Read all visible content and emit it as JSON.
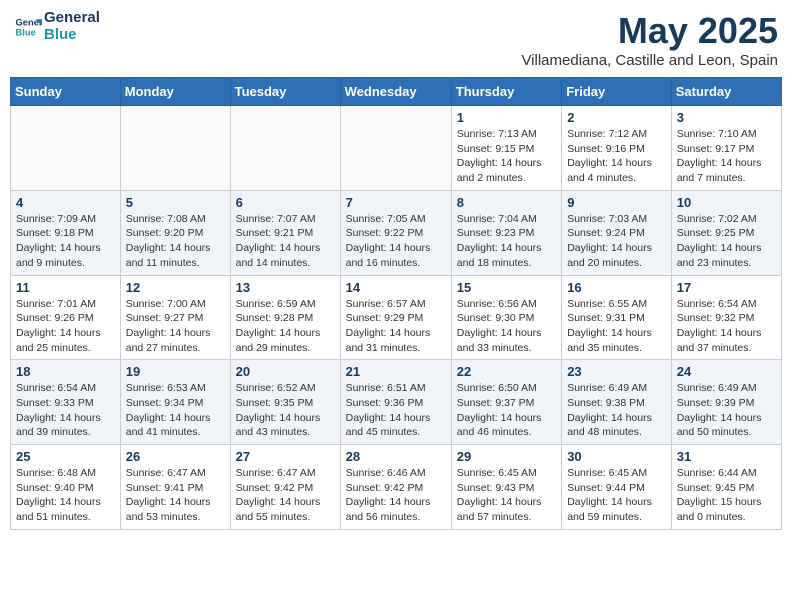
{
  "header": {
    "logo_line1": "General",
    "logo_line2": "Blue",
    "month": "May 2025",
    "location": "Villamediana, Castille and Leon, Spain"
  },
  "weekdays": [
    "Sunday",
    "Monday",
    "Tuesday",
    "Wednesday",
    "Thursday",
    "Friday",
    "Saturday"
  ],
  "weeks": [
    [
      {
        "day": "",
        "info": ""
      },
      {
        "day": "",
        "info": ""
      },
      {
        "day": "",
        "info": ""
      },
      {
        "day": "",
        "info": ""
      },
      {
        "day": "1",
        "info": "Sunrise: 7:13 AM\nSunset: 9:15 PM\nDaylight: 14 hours\nand 2 minutes."
      },
      {
        "day": "2",
        "info": "Sunrise: 7:12 AM\nSunset: 9:16 PM\nDaylight: 14 hours\nand 4 minutes."
      },
      {
        "day": "3",
        "info": "Sunrise: 7:10 AM\nSunset: 9:17 PM\nDaylight: 14 hours\nand 7 minutes."
      }
    ],
    [
      {
        "day": "4",
        "info": "Sunrise: 7:09 AM\nSunset: 9:18 PM\nDaylight: 14 hours\nand 9 minutes."
      },
      {
        "day": "5",
        "info": "Sunrise: 7:08 AM\nSunset: 9:20 PM\nDaylight: 14 hours\nand 11 minutes."
      },
      {
        "day": "6",
        "info": "Sunrise: 7:07 AM\nSunset: 9:21 PM\nDaylight: 14 hours\nand 14 minutes."
      },
      {
        "day": "7",
        "info": "Sunrise: 7:05 AM\nSunset: 9:22 PM\nDaylight: 14 hours\nand 16 minutes."
      },
      {
        "day": "8",
        "info": "Sunrise: 7:04 AM\nSunset: 9:23 PM\nDaylight: 14 hours\nand 18 minutes."
      },
      {
        "day": "9",
        "info": "Sunrise: 7:03 AM\nSunset: 9:24 PM\nDaylight: 14 hours\nand 20 minutes."
      },
      {
        "day": "10",
        "info": "Sunrise: 7:02 AM\nSunset: 9:25 PM\nDaylight: 14 hours\nand 23 minutes."
      }
    ],
    [
      {
        "day": "11",
        "info": "Sunrise: 7:01 AM\nSunset: 9:26 PM\nDaylight: 14 hours\nand 25 minutes."
      },
      {
        "day": "12",
        "info": "Sunrise: 7:00 AM\nSunset: 9:27 PM\nDaylight: 14 hours\nand 27 minutes."
      },
      {
        "day": "13",
        "info": "Sunrise: 6:59 AM\nSunset: 9:28 PM\nDaylight: 14 hours\nand 29 minutes."
      },
      {
        "day": "14",
        "info": "Sunrise: 6:57 AM\nSunset: 9:29 PM\nDaylight: 14 hours\nand 31 minutes."
      },
      {
        "day": "15",
        "info": "Sunrise: 6:56 AM\nSunset: 9:30 PM\nDaylight: 14 hours\nand 33 minutes."
      },
      {
        "day": "16",
        "info": "Sunrise: 6:55 AM\nSunset: 9:31 PM\nDaylight: 14 hours\nand 35 minutes."
      },
      {
        "day": "17",
        "info": "Sunrise: 6:54 AM\nSunset: 9:32 PM\nDaylight: 14 hours\nand 37 minutes."
      }
    ],
    [
      {
        "day": "18",
        "info": "Sunrise: 6:54 AM\nSunset: 9:33 PM\nDaylight: 14 hours\nand 39 minutes."
      },
      {
        "day": "19",
        "info": "Sunrise: 6:53 AM\nSunset: 9:34 PM\nDaylight: 14 hours\nand 41 minutes."
      },
      {
        "day": "20",
        "info": "Sunrise: 6:52 AM\nSunset: 9:35 PM\nDaylight: 14 hours\nand 43 minutes."
      },
      {
        "day": "21",
        "info": "Sunrise: 6:51 AM\nSunset: 9:36 PM\nDaylight: 14 hours\nand 45 minutes."
      },
      {
        "day": "22",
        "info": "Sunrise: 6:50 AM\nSunset: 9:37 PM\nDaylight: 14 hours\nand 46 minutes."
      },
      {
        "day": "23",
        "info": "Sunrise: 6:49 AM\nSunset: 9:38 PM\nDaylight: 14 hours\nand 48 minutes."
      },
      {
        "day": "24",
        "info": "Sunrise: 6:49 AM\nSunset: 9:39 PM\nDaylight: 14 hours\nand 50 minutes."
      }
    ],
    [
      {
        "day": "25",
        "info": "Sunrise: 6:48 AM\nSunset: 9:40 PM\nDaylight: 14 hours\nand 51 minutes."
      },
      {
        "day": "26",
        "info": "Sunrise: 6:47 AM\nSunset: 9:41 PM\nDaylight: 14 hours\nand 53 minutes."
      },
      {
        "day": "27",
        "info": "Sunrise: 6:47 AM\nSunset: 9:42 PM\nDaylight: 14 hours\nand 55 minutes."
      },
      {
        "day": "28",
        "info": "Sunrise: 6:46 AM\nSunset: 9:42 PM\nDaylight: 14 hours\nand 56 minutes."
      },
      {
        "day": "29",
        "info": "Sunrise: 6:45 AM\nSunset: 9:43 PM\nDaylight: 14 hours\nand 57 minutes."
      },
      {
        "day": "30",
        "info": "Sunrise: 6:45 AM\nSunset: 9:44 PM\nDaylight: 14 hours\nand 59 minutes."
      },
      {
        "day": "31",
        "info": "Sunrise: 6:44 AM\nSunset: 9:45 PM\nDaylight: 15 hours\nand 0 minutes."
      }
    ]
  ]
}
